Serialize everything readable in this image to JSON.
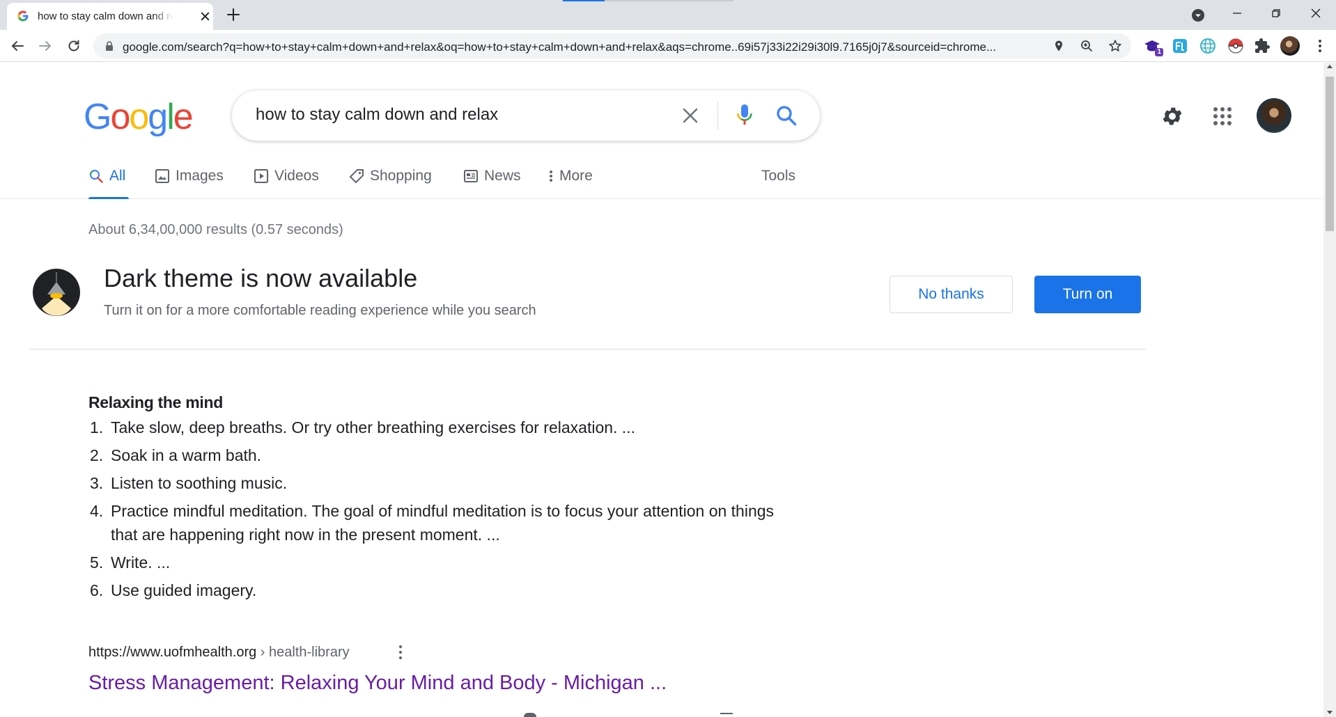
{
  "browser": {
    "tab_title": "how to stay calm down and relax",
    "url_main": "google.com/search?q=how+to+stay+calm+down+and+relax&oq=how+to+stay+calm+down+and+relax&aqs=chrome..69i57j33i22i29i30l9.7165j0j7&sourceid=chrome...",
    "extension_badge": "1",
    "icons": [
      "google-favicon",
      "tab-close-icon",
      "new-tab-icon",
      "tab-search-icon",
      "minimize-icon",
      "maximize-icon",
      "window-close-icon",
      "back-arrow-icon",
      "forward-arrow-icon",
      "reload-icon",
      "lock-icon",
      "location-pin-icon",
      "zoom-icon",
      "bookmark-star-icon",
      "puzzle-extensions-icon",
      "kebab-menu-icon"
    ]
  },
  "google": {
    "logo_letters": [
      "G",
      "o",
      "o",
      "g",
      "l",
      "e"
    ],
    "logo_colors": [
      "#4285f4",
      "#ea4335",
      "#fbbc05",
      "#4285f4",
      "#34a853",
      "#ea4335"
    ],
    "search_query": "how to stay calm down and relax",
    "tabs": [
      {
        "label": "All",
        "active": true,
        "icon": "search-icon"
      },
      {
        "label": "Images",
        "active": false,
        "icon": "image-icon"
      },
      {
        "label": "Videos",
        "active": false,
        "icon": "video-icon"
      },
      {
        "label": "Shopping",
        "active": false,
        "icon": "tag-icon"
      },
      {
        "label": "News",
        "active": false,
        "icon": "newspaper-icon"
      },
      {
        "label": "More",
        "active": false,
        "icon": "more-vertical-icon"
      }
    ],
    "tools_label": "Tools",
    "result_stats": "About 6,34,00,000 results (0.57 seconds)"
  },
  "promo": {
    "title": "Dark theme is now available",
    "subtitle": "Turn it on for a more comfortable reading experience while you search",
    "no_thanks": "No thanks",
    "turn_on": "Turn on"
  },
  "snippet": {
    "heading": "Relaxing the mind",
    "items": [
      {
        "num": "1.",
        "text": "Take slow, deep breaths. Or try other breathing exercises for relaxation. ..."
      },
      {
        "num": "2.",
        "text": "Soak in a warm bath."
      },
      {
        "num": "3.",
        "text": "Listen to soothing music."
      },
      {
        "num": "4.",
        "text": "Practice mindful meditation. The goal of mindful meditation is to focus your attention on things that are happening right now in the present moment. ..."
      },
      {
        "num": "5.",
        "text": "Write. ..."
      },
      {
        "num": "6.",
        "text": "Use guided imagery."
      }
    ],
    "cite_domain": "https://www.uofmhealth.org",
    "cite_path": " › health-library",
    "result_title": "Stress Management: Relaxing Your Mind and Body - Michigan ..."
  },
  "colors": {
    "accent": "#1a73e8",
    "visited_link": "#681da8",
    "tab_strip": "#dee1e6"
  }
}
